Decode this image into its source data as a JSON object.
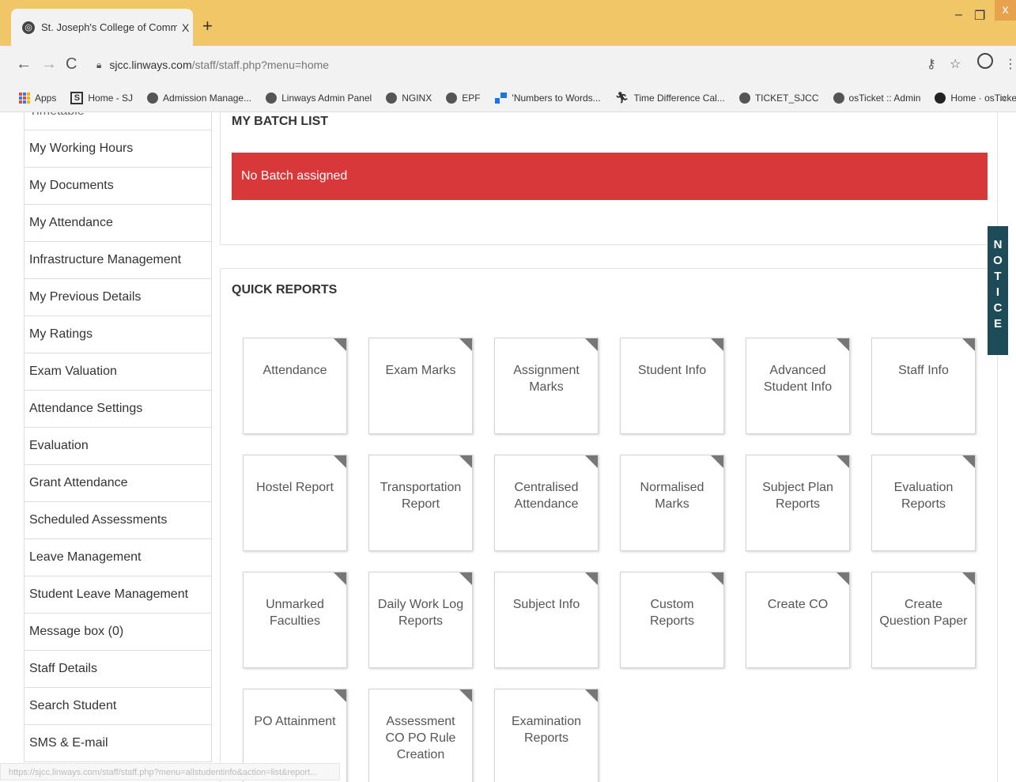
{
  "browser": {
    "tab_title": "St. Joseph's College of Commerc",
    "tab_close": "X",
    "new_tab": "+",
    "window_min": "–",
    "window_max": "❐",
    "window_close": "x",
    "url_host": "sjcc.linways.com",
    "url_path": "/staff/staff.php?menu=home",
    "bookmarks": [
      {
        "label": "Apps",
        "icon": "apps-grid-icon"
      },
      {
        "label": "Home - SJ",
        "icon": "s-logo-icon"
      },
      {
        "label": "Admission Manage...",
        "icon": "globe-icon"
      },
      {
        "label": "Linways Admin Panel",
        "icon": "globe-icon"
      },
      {
        "label": "NGINX",
        "icon": "globe-icon"
      },
      {
        "label": "EPF",
        "icon": "globe-icon"
      },
      {
        "label": "'Numbers to Words...",
        "icon": "blocks-icon"
      },
      {
        "label": "Time Difference Cal...",
        "icon": "runner-icon"
      },
      {
        "label": "TICKET_SJCC",
        "icon": "globe-icon"
      },
      {
        "label": "osTicket :: Admin",
        "icon": "globe-icon"
      },
      {
        "label": "Home · osTicket/os...",
        "icon": "github-icon"
      }
    ],
    "bookmarks_more": "»",
    "status_url": "https://sjcc.linways.com/staff/staff.php?menu=allstudentinfo&action=list&report..."
  },
  "sidebar": {
    "partial_top": "Timetable",
    "items": [
      "My Working Hours",
      "My Documents",
      "My Attendance",
      "Infrastructure Management",
      "My Previous Details",
      "My Ratings",
      "Exam Valuation",
      "Attendance Settings",
      "Evaluation",
      "Grant Attendance",
      "Scheduled Assessments",
      "Leave Management",
      "Student Leave Management",
      "Message box (0)",
      "Staff Details",
      "Search Student",
      "SMS & E-mail"
    ]
  },
  "batch": {
    "title": "MY BATCH LIST",
    "alert": "No Batch assigned"
  },
  "reports": {
    "title": "QUICK REPORTS",
    "cards": [
      "Attendance",
      "Exam Marks",
      "Assignment Marks",
      "Student Info",
      "Advanced Student Info",
      "Staff Info",
      "Hostel Report",
      "Transportation Report",
      "Centralised Attendance",
      "Normalised Marks",
      "Subject Plan Reports",
      "Evaluation Reports",
      "Unmarked Faculties",
      "Daily Work Log Reports",
      "Subject Info",
      "Custom Reports",
      "Create CO",
      "Create Question Paper",
      "PO Attainment",
      "Assessment CO PO Rule Creation",
      "Examination Reports"
    ]
  },
  "notice": {
    "letters": [
      "N",
      "O",
      "T",
      "I",
      "C",
      "E"
    ]
  },
  "colors": {
    "titlebar": "#f0c667",
    "alert": "#d9383a",
    "notice": "#1d4b57"
  }
}
